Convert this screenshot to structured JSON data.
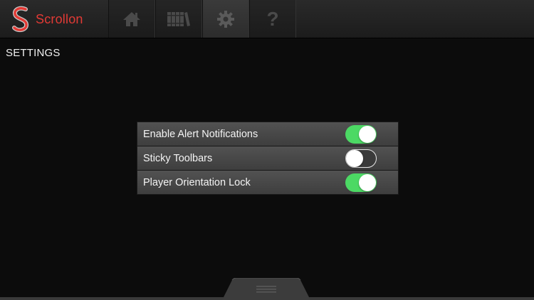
{
  "app": {
    "name": "Scrollon",
    "brand_color": "#e23a35"
  },
  "nav": {
    "tabs": [
      {
        "id": "home",
        "icon": "home-icon",
        "active": false
      },
      {
        "id": "library",
        "icon": "library-icon",
        "active": false
      },
      {
        "id": "settings",
        "icon": "gear-icon",
        "active": true
      },
      {
        "id": "help",
        "icon": "question-mark-icon",
        "glyph": "?",
        "active": false
      }
    ]
  },
  "page": {
    "title": "SETTINGS"
  },
  "settings": {
    "items": [
      {
        "label": "Enable Alert Notifications",
        "enabled": true
      },
      {
        "label": "Sticky Toolbars",
        "enabled": false
      },
      {
        "label": "Player Orientation Lock",
        "enabled": true
      }
    ],
    "toggle_on_color": "#4cd964"
  },
  "drawer": {
    "icon": "menu-lines-icon"
  }
}
